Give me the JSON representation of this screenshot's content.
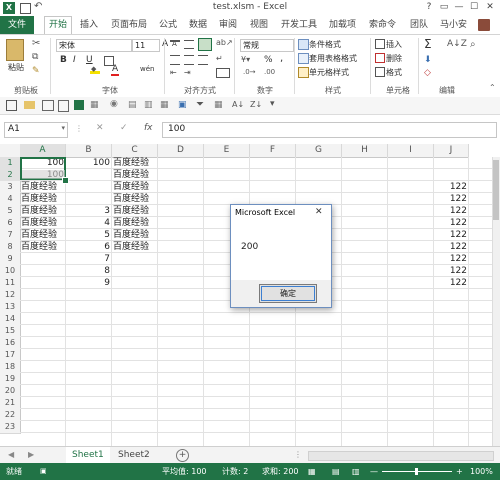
{
  "window": {
    "title": "test.xlsm - Excel",
    "controls": [
      "?",
      "▭",
      "—",
      "☐",
      "✕"
    ]
  },
  "tabs": [
    "文件",
    "开始",
    "插入",
    "页面布局",
    "公式",
    "数据",
    "审阅",
    "视图",
    "开发工具",
    "加载项",
    "索命令",
    "团队"
  ],
  "user": "马小安",
  "ribbon": {
    "paste": "粘贴",
    "font_name": "宋体",
    "font_size": "11",
    "font_grow": "A",
    "font_shrink": "A",
    "bold": "B",
    "italic": "I",
    "underline": "U",
    "font_color": "A",
    "wen": "wén",
    "number_format": "常规",
    "percent": "%",
    "comma": ",",
    "conditional_format": "条件格式",
    "table_format": "套用表格格式",
    "cell_style": "单元格样式",
    "insert": "插入",
    "delete": "删除",
    "format": "格式",
    "sum": "Σ",
    "groups": [
      "剪贴板",
      "字体",
      "对齐方式",
      "数字",
      "样式",
      "单元格",
      "编辑"
    ]
  },
  "formula_bar": {
    "name_box": "A1",
    "fx": "fx",
    "value": "100"
  },
  "grid": {
    "columns": [
      "A",
      "B",
      "C",
      "D",
      "E",
      "F",
      "G",
      "H",
      "I",
      "J"
    ],
    "rows": [
      "1",
      "2",
      "3",
      "4",
      "5",
      "6",
      "7",
      "8",
      "9",
      "10",
      "11",
      "12",
      "13",
      "14",
      "15",
      "16",
      "17",
      "18",
      "19",
      "20",
      "21",
      "22",
      "23"
    ],
    "cells": {
      "A": [
        "100",
        "100",
        "百度经验",
        "百度经验",
        "百度经验",
        "百度经验",
        "百度经验",
        "百度经验",
        "",
        "",
        ""
      ],
      "B": [
        "100",
        "",
        "",
        "",
        "3",
        "4",
        "5",
        "6",
        "7",
        "8",
        "9"
      ],
      "C": [
        "百度经验",
        "百度经验",
        "百度经验",
        "百度经验",
        "百度经验",
        "百度经验",
        "百度经验",
        "百度经验",
        "",
        "",
        ""
      ],
      "J": [
        "",
        "",
        "122",
        "122",
        "122",
        "122",
        "122",
        "122",
        "122",
        "122",
        "122"
      ]
    }
  },
  "dialog": {
    "title": "Microsoft Excel",
    "message": "200",
    "ok": "确定"
  },
  "sheets": [
    "Sheet1",
    "Sheet2"
  ],
  "status": {
    "ready": "就绪",
    "average": "平均值: 100",
    "count": "计数: 2",
    "sum": "求和: 200",
    "zoom": "100%"
  },
  "colors": {
    "accent": "#217346",
    "dialog_border": "#6d8fbf"
  }
}
